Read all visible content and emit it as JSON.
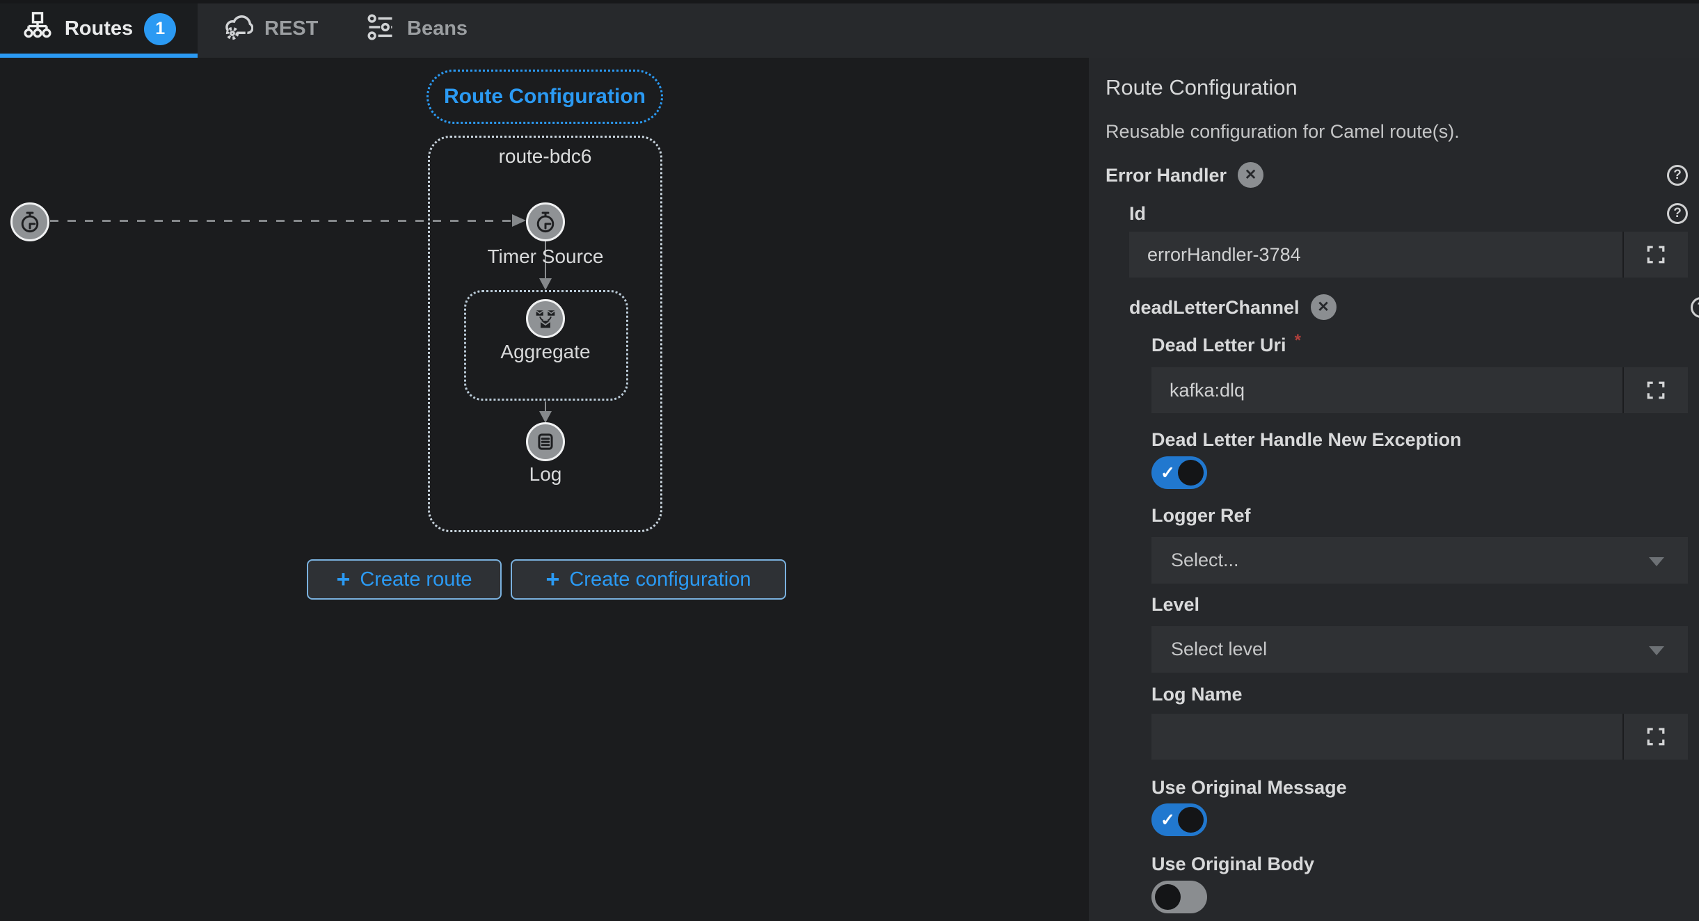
{
  "tabs": {
    "routes": {
      "label": "Routes",
      "badge": "1",
      "active": true
    },
    "rest": {
      "label": "REST"
    },
    "beans": {
      "label": "Beans"
    }
  },
  "canvas": {
    "config_pill_label": "Route Configuration",
    "route_container_label": "route-bdc6",
    "nodes": {
      "timer": {
        "label": "Timer Source",
        "icon": "stopwatch-icon"
      },
      "aggregate": {
        "label": "Aggregate",
        "icon": "aggregate-envelopes-icon"
      },
      "log": {
        "label": "Log",
        "icon": "log-lines-icon"
      }
    },
    "buttons": {
      "plus_glyph": "+",
      "create_route_label": "Create route",
      "create_configuration_label": "Create configuration"
    }
  },
  "panel": {
    "title": "Route Configuration",
    "description": "Reusable configuration for Camel route(s).",
    "required_marker": "*",
    "error_handler": {
      "label": "Error Handler",
      "removable": true
    },
    "id_field": {
      "label": "Id",
      "value": "errorHandler-3784"
    },
    "dead_letter_channel": {
      "label": "deadLetterChannel",
      "removable": true
    },
    "dead_letter_uri": {
      "label": "Dead Letter Uri",
      "value": "kafka:dlq",
      "required": true
    },
    "handle_new_exception": {
      "label": "Dead Letter Handle New Exception",
      "value": true
    },
    "logger_ref": {
      "label": "Logger Ref",
      "placeholder": "Select..."
    },
    "level": {
      "label": "Level",
      "placeholder": "Select level"
    },
    "log_name": {
      "label": "Log Name",
      "value": ""
    },
    "use_original_message": {
      "label": "Use Original Message",
      "value": true
    },
    "use_original_body": {
      "label": "Use Original Body",
      "value": false
    }
  },
  "colors": {
    "accent_blue": "#2b9af3",
    "toggle_on_blue": "#2178cf",
    "node_fill_gray": "#8f9295",
    "canvas_bg": "#1b1c1e",
    "panel_bg": "#26282b",
    "tabbar_bg": "#27292c",
    "input_bg": "#2f3134",
    "required_red": "#b1403c"
  }
}
